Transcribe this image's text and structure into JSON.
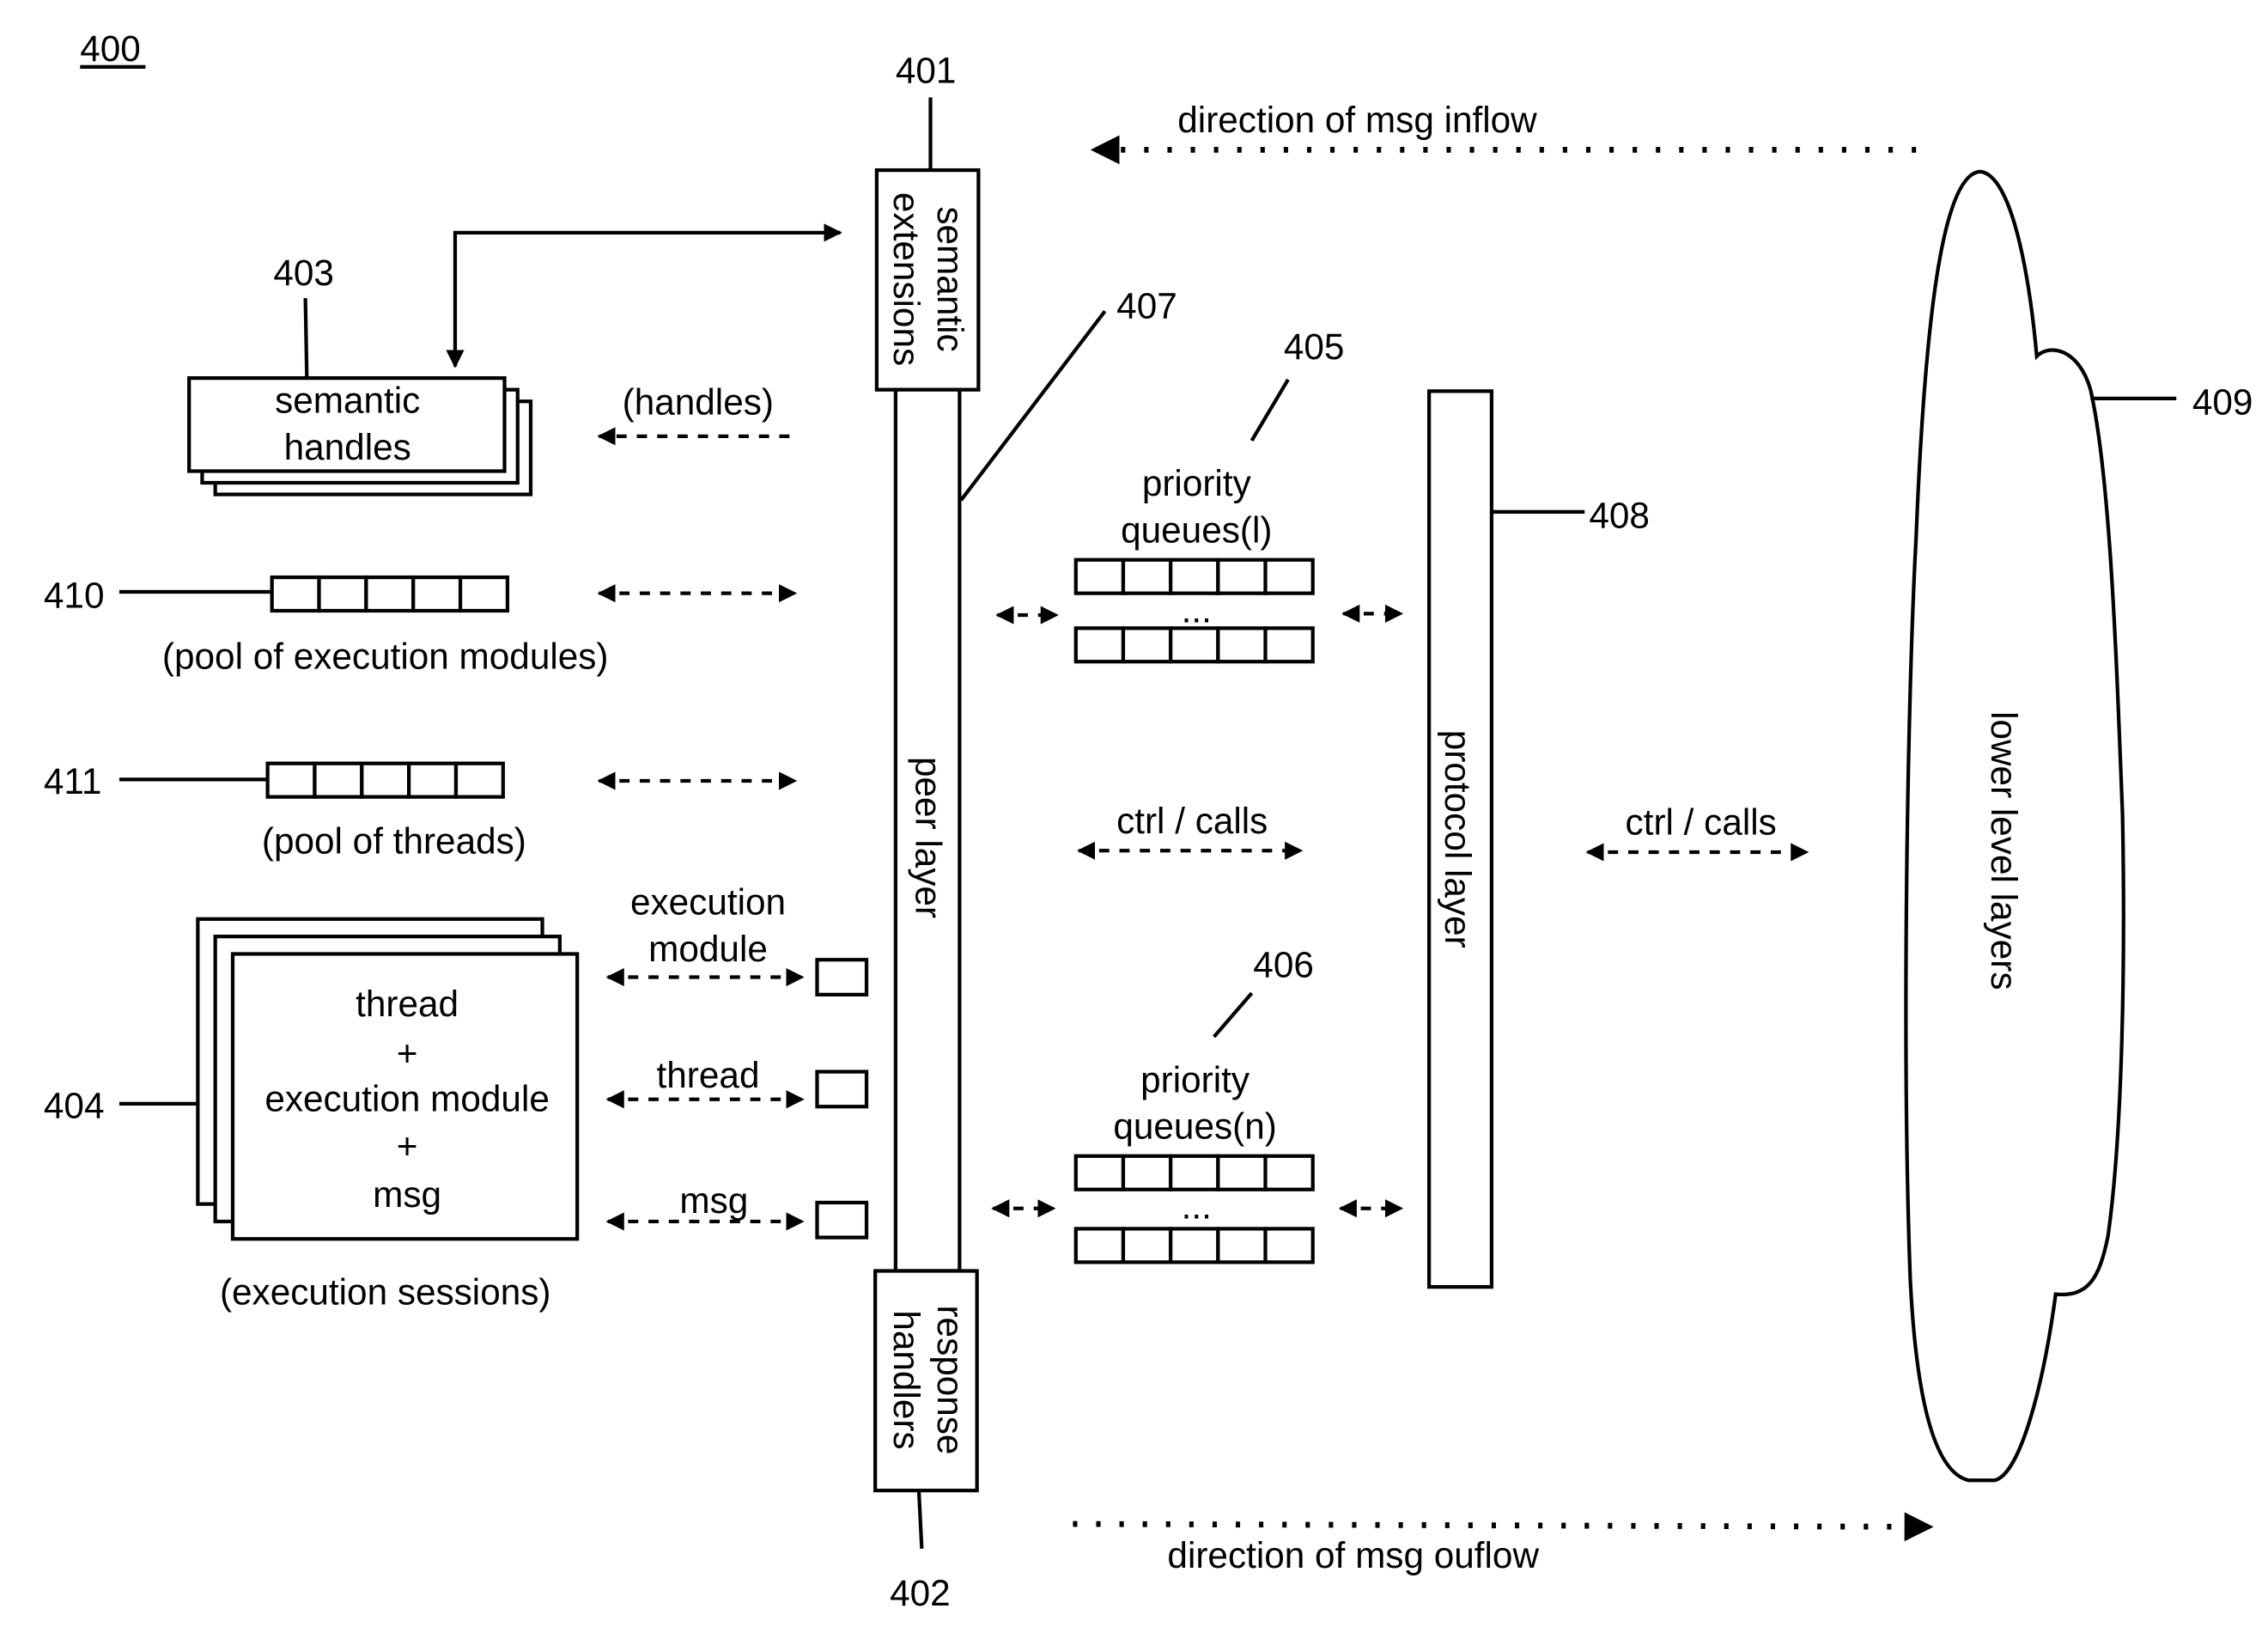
{
  "figure": {
    "figure_number": "400",
    "refs": {
      "r401": "401",
      "r402": "402",
      "r403": "403",
      "r404": "404",
      "r405": "405",
      "r406": "406",
      "r407": "407",
      "r408": "408",
      "r409": "409",
      "r410": "410",
      "r411": "411"
    },
    "flows": {
      "inflow": "direction of msg inflow",
      "outflow": "direction of msg ouflow"
    },
    "left": {
      "semantic_handles": [
        "semantic",
        "handles"
      ],
      "handles_label": "(handles)",
      "pool_modules_label": "(pool of execution modules)",
      "pool_threads_label": "(pool of threads)",
      "session_lines": [
        "thread",
        "+",
        "execution module",
        "+",
        "msg"
      ],
      "sessions_label": "(execution sessions)",
      "exec_module_label": [
        "execution",
        "module"
      ],
      "thread_label": "thread",
      "msg_label": "msg"
    },
    "peer": {
      "semantic_extensions": [
        "semantic",
        "extensions"
      ],
      "peer_layer": "peer layer",
      "response_handlers": [
        "response",
        "handlers"
      ]
    },
    "queues": {
      "upper": [
        "priority",
        "queues(l)"
      ],
      "lower": [
        "priority",
        "queues(n)"
      ],
      "ellipsis": "...",
      "ctrl_calls": "ctrl / calls"
    },
    "protocol": {
      "label": "protocol layer",
      "ctrl_calls": "ctrl / calls"
    },
    "cloud": {
      "label": "lower level layers"
    }
  }
}
